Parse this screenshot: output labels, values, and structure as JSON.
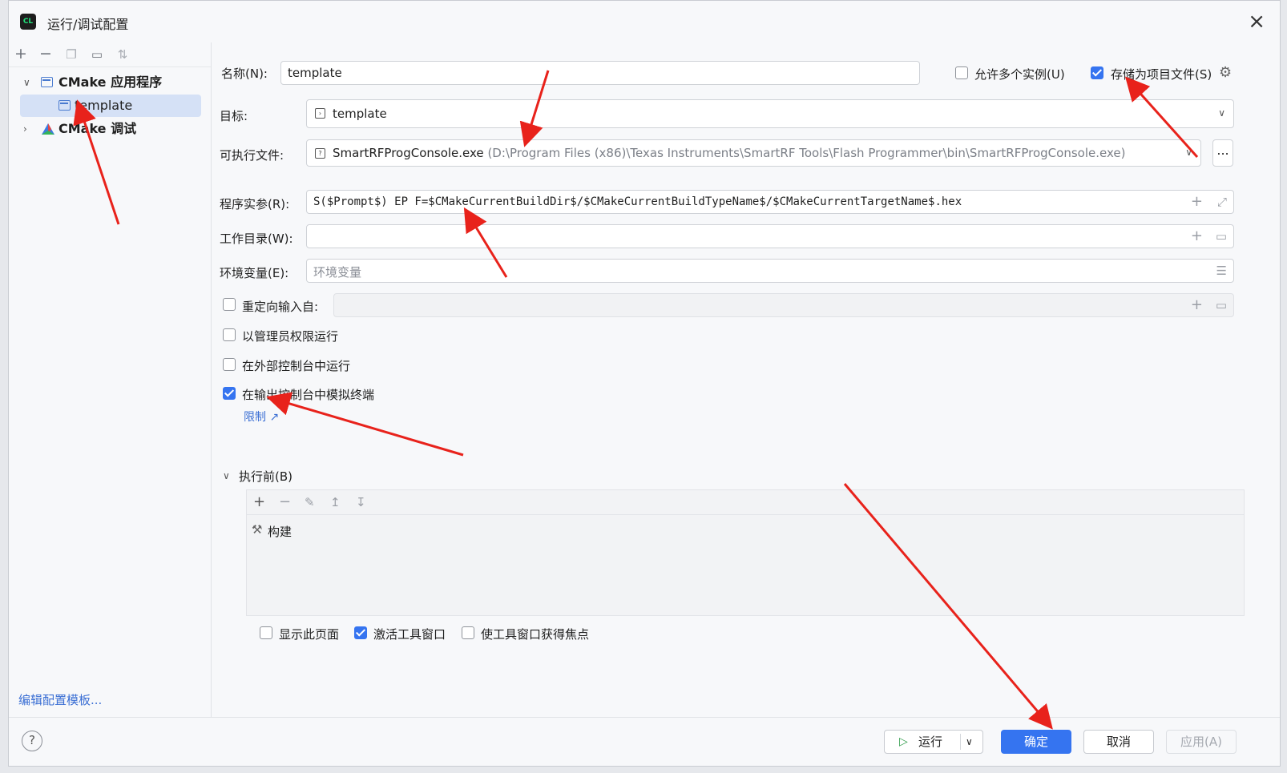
{
  "window": {
    "title": "运行/调试配置",
    "app_icon": "CL"
  },
  "sidebar": {
    "tree": [
      {
        "label": "CMake 应用程序",
        "expanded": true
      },
      {
        "label": "template",
        "selected": true
      },
      {
        "label": "CMake 调试",
        "expanded": false
      }
    ],
    "edit_templates_link": "编辑配置模板..."
  },
  "form": {
    "name_label": "名称(N):",
    "name_value": "template",
    "allow_multiple_label": "允许多个实例(U)",
    "allow_multiple_checked": false,
    "store_project_label": "存储为项目文件(S)",
    "store_project_checked": true,
    "target_label": "目标:",
    "target_value": "template",
    "executable_label": "可执行文件:",
    "executable_name": "SmartRFProgConsole.exe",
    "executable_path": "(D:\\Program Files (x86)\\Texas Instruments\\SmartRF Tools\\Flash Programmer\\bin\\SmartRFProgConsole.exe)",
    "browse_button": "...",
    "args_label": "程序实参(R):",
    "args_value": "S($Prompt$) EP F=$CMakeCurrentBuildDir$/$CMakeCurrentBuildTypeName$/$CMakeCurrentTargetName$.hex",
    "workdir_label": "工作目录(W):",
    "workdir_value": "",
    "env_label": "环境变量(E):",
    "env_placeholder": "环境变量",
    "redirect_label": "重定向输入自:",
    "redirect_checked": false,
    "admin_label": "以管理员权限运行",
    "admin_checked": false,
    "external_console_label": "在外部控制台中运行",
    "external_console_checked": false,
    "emulate_terminal_label": "在输出控制台中模拟终端",
    "emulate_terminal_checked": true,
    "limit_link": "限制 ↗"
  },
  "before_launch": {
    "section_label": "执行前(B)",
    "items": [
      {
        "label": "构建"
      }
    ],
    "show_page_label": "显示此页面",
    "show_page_checked": false,
    "activate_tool_label": "激活工具窗口",
    "activate_tool_checked": true,
    "focus_tool_label": "使工具窗口获得焦点",
    "focus_tool_checked": false
  },
  "footer": {
    "run_label": "运行",
    "ok_label": "确定",
    "cancel_label": "取消",
    "apply_label": "应用(A)"
  },
  "colors": {
    "accent": "#3574f0",
    "annotation_arrow": "#e8221b",
    "link": "#3b6fd4"
  }
}
